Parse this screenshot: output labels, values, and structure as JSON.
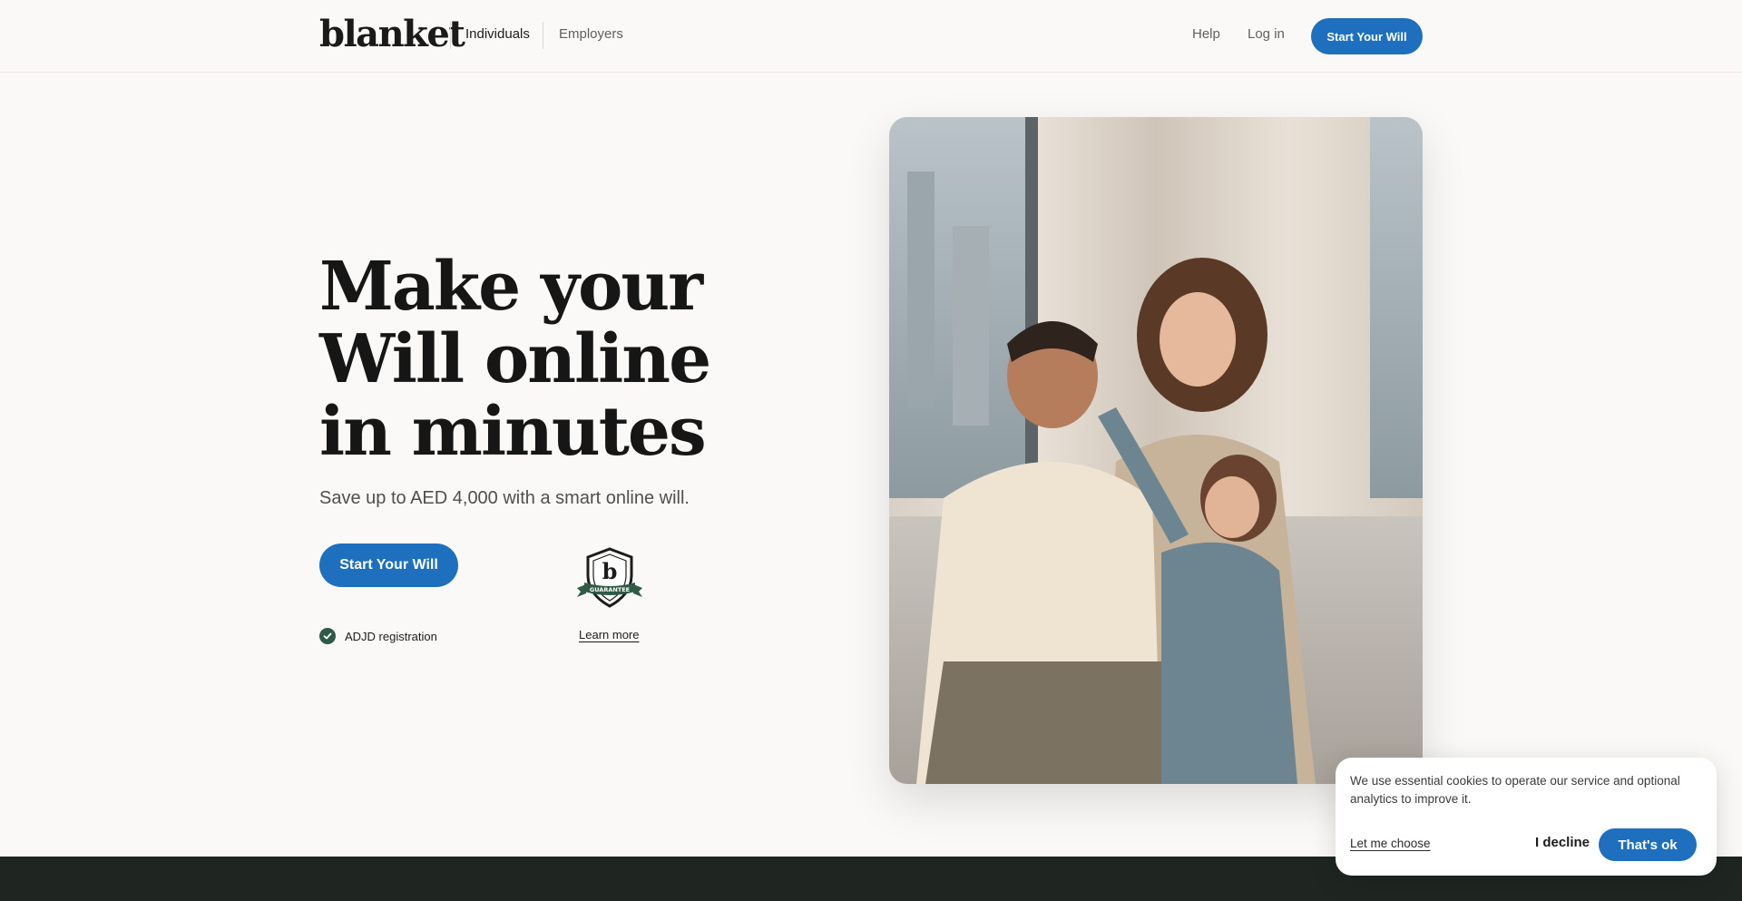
{
  "header": {
    "logo": "blanket",
    "nav": [
      {
        "label": "Individuals"
      },
      {
        "label": "Employers"
      }
    ],
    "help": "Help",
    "login": "Log in",
    "cta": "Start Your Will"
  },
  "hero": {
    "title_line1": "Make your",
    "title_line2": "Will online",
    "title_line3": "in minutes",
    "subtitle": "Save up to AED 4,000 with a smart online will.",
    "cta": "Start Your Will",
    "registration": "ADJD registration",
    "guarantee_letter": "b",
    "guarantee_label": "GUARANTEE",
    "learn_more": "Learn more"
  },
  "cookie": {
    "message": "We use essential cookies to operate our service and optional analytics to improve it.",
    "choose": "Let me choose",
    "decline": "I decline",
    "accept": "That's ok"
  },
  "colors": {
    "accent": "#1e6fbe",
    "dark_band": "#1f2622",
    "background": "#faf9f7",
    "badge_green": "#2f5a47"
  }
}
